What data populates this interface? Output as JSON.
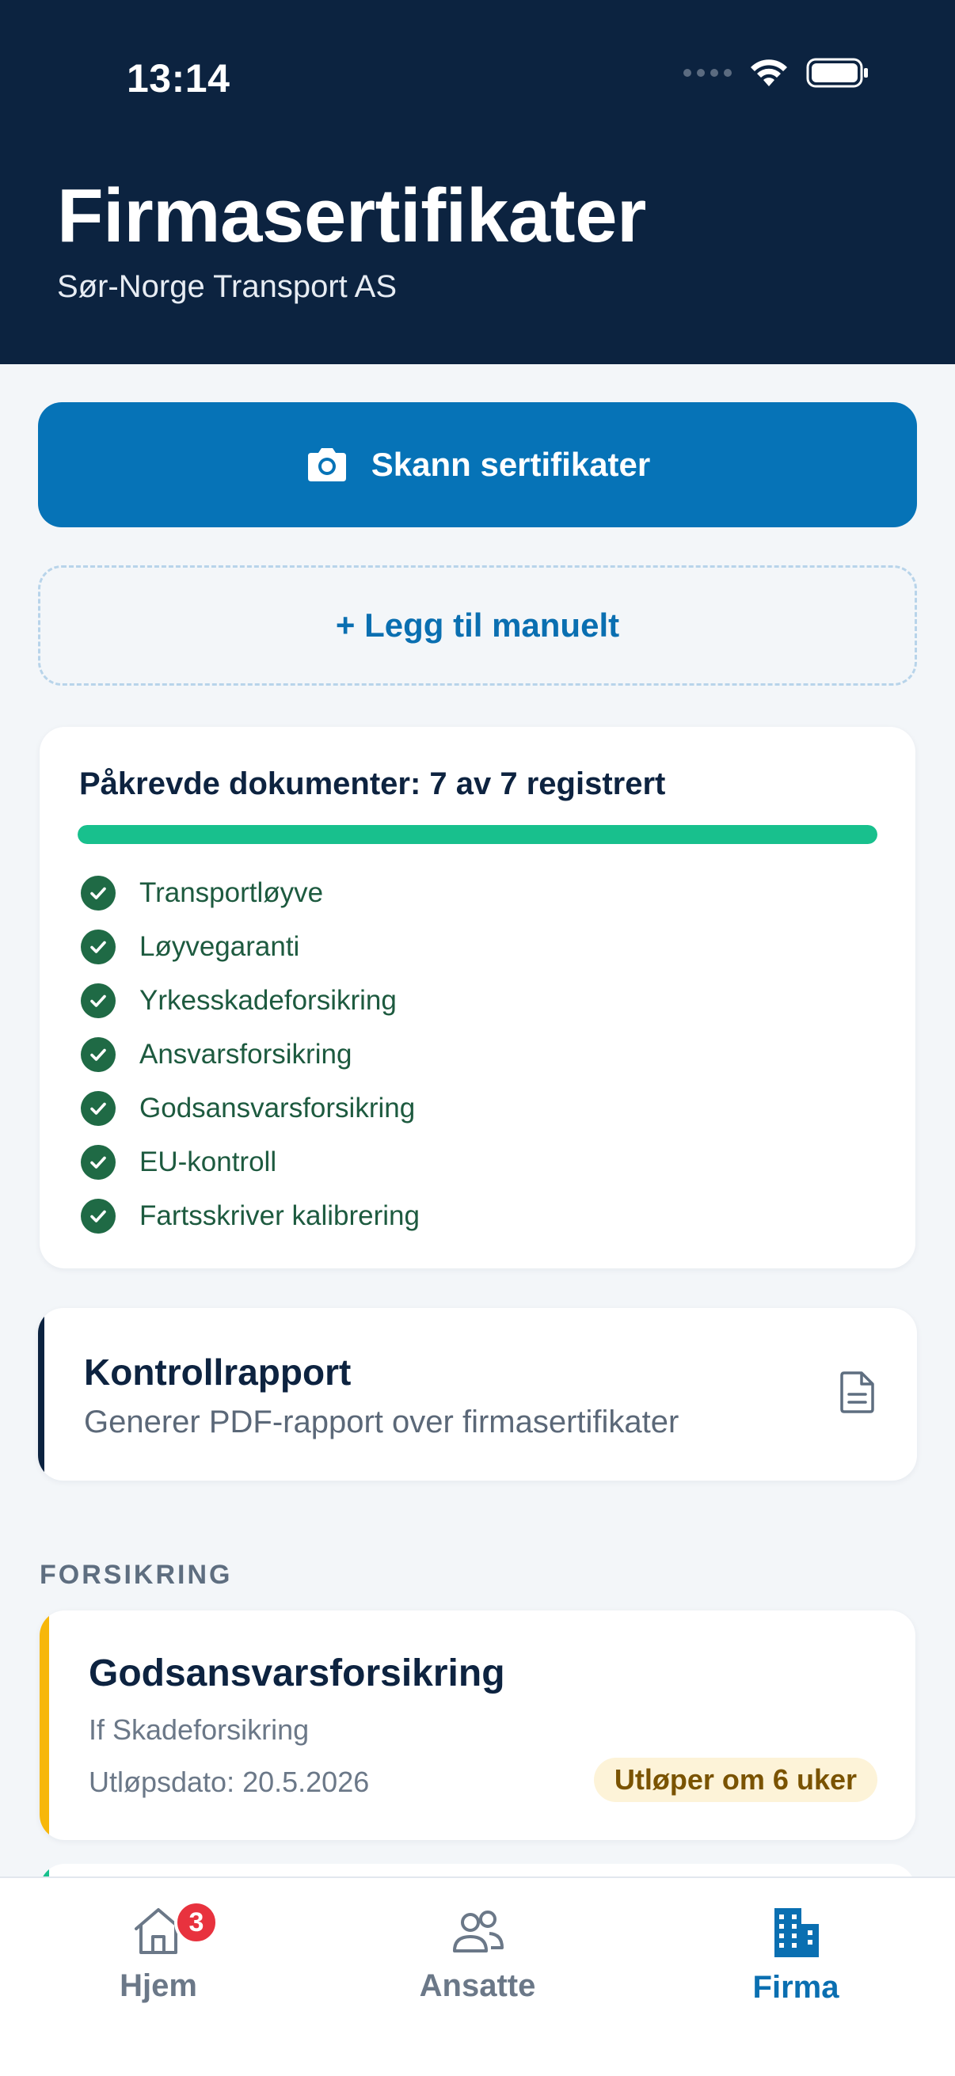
{
  "status_bar": {
    "time": "13:14"
  },
  "header": {
    "title": "Firmasertifikater",
    "subtitle": "Sør-Norge Transport AS"
  },
  "actions": {
    "scan_label": "Skann sertifikater",
    "manual_label": "+ Legg til manuelt"
  },
  "requirements": {
    "title": "Påkrevde dokumenter: 7 av 7 registrert",
    "progress": 1.0,
    "items": [
      "Transportløyve",
      "Løyvegaranti",
      "Yrkesskadeforsikring",
      "Ansvarsforsikring",
      "Godsansvarsforsikring",
      "EU-kontroll",
      "Fartsskriver kalibrering"
    ]
  },
  "report": {
    "title": "Kontrollrapport",
    "subtitle": "Generer PDF-rapport over firmasertifikater"
  },
  "section": {
    "label": "FORSIKRING"
  },
  "certificate": {
    "title": "Godsansvarsforsikring",
    "issuer": "If Skadeforsikring",
    "expiry": "Utløpsdato: 20.5.2026",
    "badge": "Utløper om 6 uker"
  },
  "tabs": [
    {
      "label": "Hjem",
      "icon": "home-icon",
      "badge": "3"
    },
    {
      "label": "Ansatte",
      "icon": "users-icon"
    },
    {
      "label": "Firma",
      "icon": "building-icon",
      "active": true
    }
  ],
  "colors": {
    "header_bg": "#0c2340",
    "primary": "#0673b7",
    "success": "#18c08d",
    "warning": "#f7b70a",
    "badge": "#e8323e"
  }
}
